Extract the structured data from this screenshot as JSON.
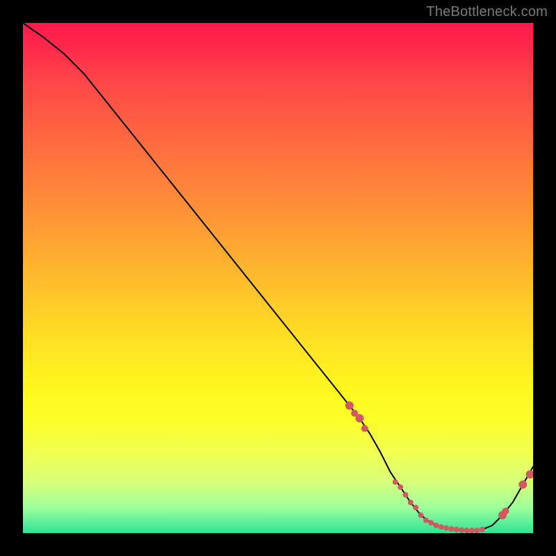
{
  "watermark": "TheBottleneck.com",
  "chart_data": {
    "type": "line",
    "title": "",
    "xlabel": "",
    "ylabel": "",
    "xlim": [
      0,
      100
    ],
    "ylim": [
      0,
      100
    ],
    "grid": false,
    "legend": false,
    "series": [
      {
        "name": "bottleneck-curve",
        "x": [
          0,
          4,
          8,
          12,
          20,
          30,
          40,
          50,
          60,
          64,
          66,
          68,
          70,
          72,
          74,
          76,
          78,
          80,
          82,
          84,
          86,
          88,
          90,
          92,
          94,
          96,
          98,
          100
        ],
        "y": [
          100,
          97.2,
          94,
          90,
          80,
          67.5,
          55,
          42.5,
          30,
          25,
          22.5,
          19.5,
          16,
          12,
          9,
          6,
          3.5,
          2,
          1.2,
          0.7,
          0.5,
          0.5,
          0.7,
          1.5,
          3.5,
          6,
          9.5,
          13
        ]
      }
    ],
    "scatter_points": {
      "name": "highlight-points",
      "x": [
        64,
        65,
        66,
        67,
        73,
        74,
        75,
        76,
        77,
        78,
        79,
        80,
        81,
        82,
        83,
        84,
        85,
        86,
        87,
        88,
        89,
        90,
        94,
        94.6,
        98,
        99.4
      ],
      "y": [
        25,
        23.5,
        22.5,
        20.5,
        10,
        9,
        7.5,
        6,
        5,
        3.5,
        2.5,
        2,
        1.5,
        1.2,
        1,
        0.8,
        0.7,
        0.6,
        0.5,
        0.5,
        0.5,
        0.7,
        3.5,
        4.3,
        9.5,
        11.5
      ],
      "r": [
        6,
        5,
        6,
        5,
        4,
        4,
        4,
        4,
        4,
        4,
        4,
        4,
        4,
        4,
        4,
        4,
        4,
        4,
        4,
        4,
        4,
        4,
        6,
        5,
        6,
        6
      ]
    }
  }
}
